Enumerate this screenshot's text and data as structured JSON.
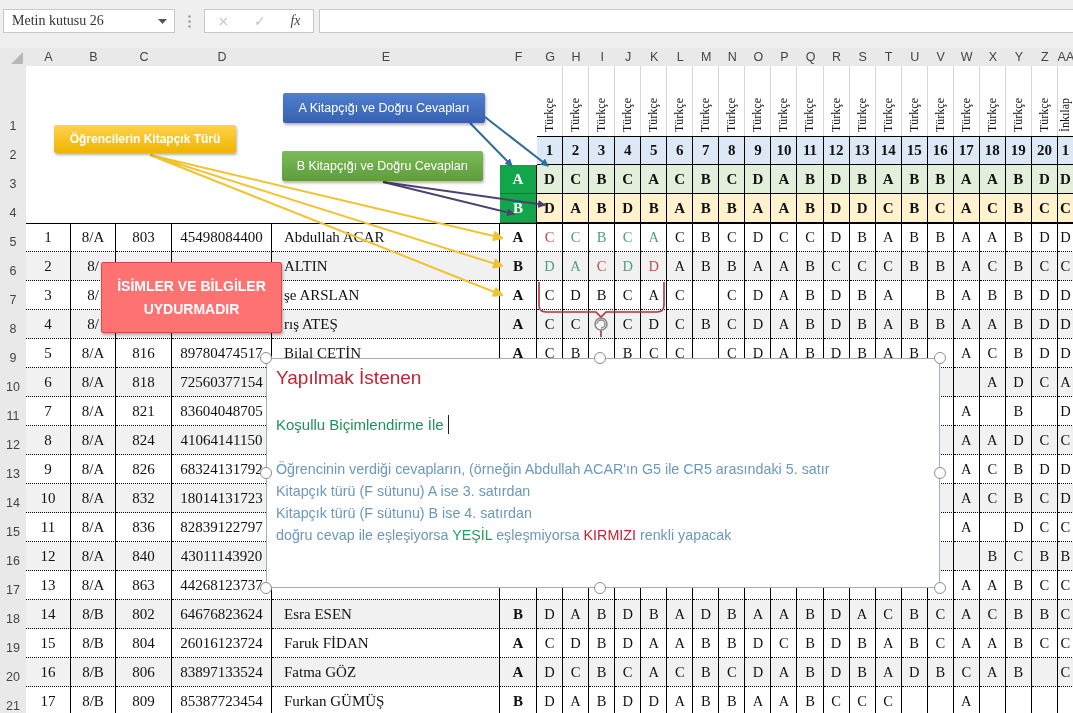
{
  "name_box": {
    "value": "Metin kutusu 26"
  },
  "formula_buttons": [
    {
      "label": "×",
      "disabled": true
    },
    {
      "label": "✓",
      "disabled": true
    },
    {
      "label": "fx",
      "disabled": false
    }
  ],
  "columns": [
    "A",
    "B",
    "C",
    "D",
    "E",
    "F",
    "G",
    "H",
    "I",
    "J",
    "K",
    "L",
    "M",
    "N",
    "O",
    "P",
    "Q",
    "R",
    "S",
    "T",
    "U",
    "V",
    "W",
    "X",
    "Y",
    "Z",
    "AA"
  ],
  "subject_row": {
    "number": "1",
    "subjects": [
      "Türkçe",
      "Türkçe",
      "Türkçe",
      "Türkçe",
      "Türkçe",
      "Türkçe",
      "Türkçe",
      "Türkçe",
      "Türkçe",
      "Türkçe",
      "Türkçe",
      "Türkçe",
      "Türkçe",
      "Türkçe",
      "Türkçe",
      "Türkçe",
      "Türkçe",
      "Türkçe",
      "Türkçe",
      "Türkçe",
      "İnkılap"
    ]
  },
  "question_row": {
    "number": "2",
    "questions": [
      "1",
      "2",
      "3",
      "4",
      "5",
      "6",
      "7",
      "8",
      "9",
      "10",
      "11",
      "12",
      "13",
      "14",
      "15",
      "16",
      "17",
      "18",
      "19",
      "20",
      "1"
    ]
  },
  "key_rows": [
    {
      "number": "3",
      "booklet": "A",
      "color": "#e2efda",
      "answers": [
        "D",
        "C",
        "B",
        "C",
        "A",
        "C",
        "B",
        "C",
        "D",
        "A",
        "B",
        "D",
        "B",
        "A",
        "B",
        "B",
        "A",
        "A",
        "B",
        "D",
        "D"
      ]
    },
    {
      "number": "4",
      "booklet": "B",
      "color": "#fff2cc",
      "answers": [
        "D",
        "A",
        "B",
        "D",
        "B",
        "A",
        "B",
        "B",
        "A",
        "A",
        "B",
        "D",
        "D",
        "C",
        "B",
        "C",
        "A",
        "C",
        "B",
        "C",
        "C"
      ]
    }
  ],
  "students": [
    {
      "number": "5",
      "no": "1",
      "class": "8/A",
      "school_no": "803",
      "id": "45498084400",
      "name": "Abdullah ACAR",
      "booklet": "A",
      "answers": [
        {
          "kind": "mark",
          "value": "C",
          "color": "#c0504d"
        },
        {
          "kind": "mark",
          "value": "C",
          "color": "#4f9d7f"
        },
        {
          "kind": "mark",
          "value": "B",
          "color": "#4f9d7f"
        },
        {
          "kind": "mark",
          "value": "C",
          "color": "#4f9d7f"
        },
        {
          "kind": "mark",
          "value": "A",
          "color": "#4f9d7f"
        },
        {
          "kind": "mark",
          "value": "C"
        },
        {
          "kind": "mark",
          "value": "B"
        },
        {
          "kind": "mark",
          "value": "C"
        },
        {
          "kind": "mark",
          "value": "D"
        },
        {
          "kind": "mark",
          "value": "C"
        },
        {
          "kind": "mark",
          "value": "C"
        },
        {
          "kind": "mark",
          "value": "D"
        },
        {
          "kind": "mark",
          "value": "B"
        },
        {
          "kind": "mark",
          "value": "A"
        },
        {
          "kind": "mark",
          "value": "B"
        },
        {
          "kind": "mark",
          "value": "B"
        },
        {
          "kind": "mark",
          "value": "A"
        },
        {
          "kind": "mark",
          "value": "A"
        },
        {
          "kind": "mark",
          "value": "B"
        },
        {
          "kind": "mark",
          "value": "D"
        },
        {
          "kind": "mark",
          "value": "D"
        }
      ]
    },
    {
      "number": "6",
      "no": "2",
      "class": "8/",
      "name": "ALTIN",
      "booklet": "B",
      "answers": [
        {
          "kind": "mark",
          "value": "D",
          "color": "#4f9d7f"
        },
        {
          "kind": "mark",
          "value": "A",
          "color": "#4f9d7f"
        },
        {
          "kind": "mark",
          "value": "C",
          "color": "#c0504d"
        },
        {
          "kind": "mark",
          "value": "D",
          "color": "#4f9d7f"
        },
        {
          "kind": "mark",
          "value": "D",
          "color": "#c0504d"
        },
        {
          "kind": "mark",
          "value": "A"
        },
        {
          "kind": "mark",
          "value": "B"
        },
        {
          "kind": "mark",
          "value": "B"
        },
        {
          "kind": "mark",
          "value": "A"
        },
        {
          "kind": "mark",
          "value": "A"
        },
        {
          "kind": "mark",
          "value": "B"
        },
        {
          "kind": "mark",
          "value": "C"
        },
        {
          "kind": "mark",
          "value": "C"
        },
        {
          "kind": "mark",
          "value": "C"
        },
        {
          "kind": "mark",
          "value": "B"
        },
        {
          "kind": "mark",
          "value": "B"
        },
        {
          "kind": "mark",
          "value": "A"
        },
        {
          "kind": "mark",
          "value": "C"
        },
        {
          "kind": "mark",
          "value": "B"
        },
        {
          "kind": "mark",
          "value": "C"
        },
        {
          "kind": "mark",
          "value": "C"
        }
      ]
    },
    {
      "number": "7",
      "no": "3",
      "class": "8/",
      "name": "şe ARSLAN",
      "booklet": "A",
      "answers": [
        {
          "kind": "mark",
          "value": "C"
        },
        {
          "kind": "mark",
          "value": "D"
        },
        {
          "kind": "mark",
          "value": "B"
        },
        {
          "kind": "mark",
          "value": "C"
        },
        {
          "kind": "mark",
          "value": "A"
        },
        {
          "kind": "mark",
          "value": "C"
        },
        {
          "kind": "empty"
        },
        {
          "kind": "mark",
          "value": "C"
        },
        {
          "kind": "mark",
          "value": "D"
        },
        {
          "kind": "mark",
          "value": "A"
        },
        {
          "kind": "mark",
          "value": "B"
        },
        {
          "kind": "mark",
          "value": "D"
        },
        {
          "kind": "mark",
          "value": "B"
        },
        {
          "kind": "mark",
          "value": "A"
        },
        {
          "kind": "empty"
        },
        {
          "kind": "mark",
          "value": "B"
        },
        {
          "kind": "mark",
          "value": "A"
        },
        {
          "kind": "mark",
          "value": "B"
        },
        {
          "kind": "mark",
          "value": "B"
        },
        {
          "kind": "mark",
          "value": "D"
        },
        {
          "kind": "mark",
          "value": "D"
        }
      ]
    },
    {
      "number": "8",
      "no": "4",
      "class": "8/",
      "name": "rış ATEŞ",
      "booklet": "A",
      "answers": [
        {
          "kind": "mark",
          "value": "C"
        },
        {
          "kind": "mark",
          "value": "C"
        },
        {
          "kind": "empty"
        },
        {
          "kind": "mark",
          "value": "C"
        },
        {
          "kind": "mark",
          "value": "D"
        },
        {
          "kind": "mark",
          "value": "C"
        },
        {
          "kind": "mark",
          "value": "B"
        },
        {
          "kind": "mark",
          "value": "C"
        },
        {
          "kind": "mark",
          "value": "D"
        },
        {
          "kind": "mark",
          "value": "A"
        },
        {
          "kind": "mark",
          "value": "B"
        },
        {
          "kind": "mark",
          "value": "D"
        },
        {
          "kind": "mark",
          "value": "B"
        },
        {
          "kind": "mark",
          "value": "A"
        },
        {
          "kind": "mark",
          "value": "B"
        },
        {
          "kind": "mark",
          "value": "B"
        },
        {
          "kind": "mark",
          "value": "A"
        },
        {
          "kind": "mark",
          "value": "A"
        },
        {
          "kind": "mark",
          "value": "B"
        },
        {
          "kind": "mark",
          "value": "D"
        },
        {
          "kind": "mark",
          "value": "D"
        }
      ]
    },
    {
      "number": "9",
      "no": "5",
      "class": "8/A",
      "school_no": "816",
      "id": "89780474517",
      "name": "Bilal ÇETİN",
      "booklet": "A",
      "answers": [
        {
          "kind": "mark",
          "value": "C"
        },
        {
          "kind": "mark",
          "value": "B"
        },
        {
          "kind": "empty"
        },
        {
          "kind": "mark",
          "value": "B"
        },
        {
          "kind": "mark",
          "value": "C"
        },
        {
          "kind": "mark",
          "value": "C"
        },
        {
          "kind": "empty"
        },
        {
          "kind": "mark",
          "value": "C"
        },
        {
          "kind": "mark",
          "value": "D"
        },
        {
          "kind": "mark",
          "value": "A"
        },
        {
          "kind": "mark",
          "value": "B"
        },
        {
          "kind": "mark",
          "value": "D"
        },
        {
          "kind": "mark",
          "value": "B"
        },
        {
          "kind": "mark",
          "value": "A"
        },
        {
          "kind": "mark",
          "value": "B"
        },
        {
          "kind": "empty"
        },
        {
          "kind": "mark",
          "value": "A"
        },
        {
          "kind": "mark",
          "value": "C"
        },
        {
          "kind": "mark",
          "value": "B"
        },
        {
          "kind": "mark",
          "value": "D"
        },
        {
          "kind": "mark",
          "value": "D"
        }
      ]
    },
    {
      "number": "10",
      "no": "6",
      "class": "8/A",
      "school_no": "818",
      "id": "72560377154",
      "answers": [
        {
          "kind": "empty"
        },
        {
          "kind": "mark",
          "value": "A"
        },
        {
          "kind": "mark",
          "value": "D"
        },
        {
          "kind": "mark",
          "value": "C"
        },
        {
          "kind": "mark",
          "value": "A"
        }
      ]
    },
    {
      "number": "11",
      "no": "7",
      "class": "8/A",
      "school_no": "821",
      "id": "83604048705",
      "answers": [
        {
          "kind": "mark",
          "value": "A"
        },
        {
          "kind": "empty"
        },
        {
          "kind": "mark",
          "value": "B"
        },
        {
          "kind": "empty"
        },
        {
          "kind": "mark",
          "value": "D"
        }
      ]
    },
    {
      "number": "12",
      "no": "8",
      "class": "8/A",
      "school_no": "824",
      "id": "41064141150",
      "answers": [
        {
          "kind": "mark",
          "value": "A"
        },
        {
          "kind": "mark",
          "value": "A"
        },
        {
          "kind": "mark",
          "value": "D"
        },
        {
          "kind": "mark",
          "value": "C"
        },
        {
          "kind": "mark",
          "value": "C"
        }
      ]
    },
    {
      "number": "13",
      "no": "9",
      "class": "8/A",
      "school_no": "826",
      "id": "68324131792",
      "answers": [
        {
          "kind": "mark",
          "value": "A"
        },
        {
          "kind": "mark",
          "value": "C"
        },
        {
          "kind": "mark",
          "value": "B"
        },
        {
          "kind": "mark",
          "value": "D"
        },
        {
          "kind": "mark",
          "value": "D"
        }
      ]
    },
    {
      "number": "14",
      "no": "10",
      "class": "8/A",
      "school_no": "832",
      "id": "18014131723",
      "answers": [
        {
          "kind": "mark",
          "value": "A"
        },
        {
          "kind": "mark",
          "value": "C"
        },
        {
          "kind": "mark",
          "value": "B"
        },
        {
          "kind": "mark",
          "value": "C"
        },
        {
          "kind": "mark",
          "value": "D"
        }
      ]
    },
    {
      "number": "15",
      "no": "11",
      "class": "8/A",
      "school_no": "836",
      "id": "82839122797",
      "answers": [
        {
          "kind": "mark",
          "value": "A"
        },
        {
          "kind": "empty"
        },
        {
          "kind": "mark",
          "value": "D"
        },
        {
          "kind": "mark",
          "value": "C"
        },
        {
          "kind": "mark",
          "value": "C"
        }
      ]
    },
    {
      "number": "16",
      "no": "12",
      "class": "8/A",
      "school_no": "840",
      "id": "43011143920",
      "answers": [
        {
          "kind": "empty"
        },
        {
          "kind": "mark",
          "value": "B"
        },
        {
          "kind": "mark",
          "value": "C"
        },
        {
          "kind": "mark",
          "value": "B"
        },
        {
          "kind": "mark",
          "value": "B"
        }
      ]
    },
    {
      "number": "17",
      "no": "13",
      "class": "8/A",
      "school_no": "863",
      "id": "44268123737",
      "answers": [
        {
          "kind": "mark",
          "value": "A"
        },
        {
          "kind": "mark",
          "value": "A"
        },
        {
          "kind": "mark",
          "value": "B"
        },
        {
          "kind": "mark",
          "value": "C"
        },
        {
          "kind": "mark",
          "value": "C"
        }
      ]
    },
    {
      "number": "18",
      "no": "14",
      "class": "8/B",
      "school_no": "802",
      "id": "64676823624",
      "name": "Esra ESEN",
      "booklet": "B",
      "answers": [
        {
          "kind": "mark",
          "value": "D"
        },
        {
          "kind": "mark",
          "value": "A"
        },
        {
          "kind": "mark",
          "value": "B"
        },
        {
          "kind": "mark",
          "value": "D"
        },
        {
          "kind": "mark",
          "value": "B"
        },
        {
          "kind": "mark",
          "value": "A"
        },
        {
          "kind": "mark",
          "value": "D"
        },
        {
          "kind": "mark",
          "value": "B"
        },
        {
          "kind": "mark",
          "value": "A"
        },
        {
          "kind": "mark",
          "value": "A"
        },
        {
          "kind": "mark",
          "value": "B"
        },
        {
          "kind": "mark",
          "value": "D"
        },
        {
          "kind": "mark",
          "value": "A"
        },
        {
          "kind": "mark",
          "value": "C"
        },
        {
          "kind": "mark",
          "value": "B"
        },
        {
          "kind": "mark",
          "value": "C"
        },
        {
          "kind": "mark",
          "value": "A"
        },
        {
          "kind": "mark",
          "value": "C"
        },
        {
          "kind": "mark",
          "value": "B"
        },
        {
          "kind": "mark",
          "value": "B"
        },
        {
          "kind": "mark",
          "value": "C"
        }
      ]
    },
    {
      "number": "19",
      "no": "15",
      "class": "8/B",
      "school_no": "804",
      "id": "26016123724",
      "name": "Faruk FİDAN",
      "booklet": "A",
      "answers": [
        {
          "kind": "mark",
          "value": "C"
        },
        {
          "kind": "mark",
          "value": "D"
        },
        {
          "kind": "mark",
          "value": "B"
        },
        {
          "kind": "mark",
          "value": "D"
        },
        {
          "kind": "mark",
          "value": "A"
        },
        {
          "kind": "mark",
          "value": "A"
        },
        {
          "kind": "mark",
          "value": "B"
        },
        {
          "kind": "mark",
          "value": "B"
        },
        {
          "kind": "mark",
          "value": "D"
        },
        {
          "kind": "mark",
          "value": "C"
        },
        {
          "kind": "mark",
          "value": "B"
        },
        {
          "kind": "mark",
          "value": "D"
        },
        {
          "kind": "mark",
          "value": "B"
        },
        {
          "kind": "mark",
          "value": "A"
        },
        {
          "kind": "mark",
          "value": "B"
        },
        {
          "kind": "mark",
          "value": "C"
        },
        {
          "kind": "mark",
          "value": "A"
        },
        {
          "kind": "mark",
          "value": "A"
        },
        {
          "kind": "mark",
          "value": "B"
        },
        {
          "kind": "mark",
          "value": "C"
        },
        {
          "kind": "mark",
          "value": "C"
        }
      ]
    },
    {
      "number": "20",
      "no": "16",
      "class": "8/B",
      "school_no": "806",
      "id": "83897133524",
      "name": "Fatma GÖZ",
      "booklet": "A",
      "answers": [
        {
          "kind": "mark",
          "value": "D"
        },
        {
          "kind": "mark",
          "value": "C"
        },
        {
          "kind": "mark",
          "value": "B"
        },
        {
          "kind": "mark",
          "value": "C"
        },
        {
          "kind": "mark",
          "value": "A"
        },
        {
          "kind": "mark",
          "value": "C"
        },
        {
          "kind": "mark",
          "value": "B"
        },
        {
          "kind": "mark",
          "value": "C"
        },
        {
          "kind": "mark",
          "value": "D"
        },
        {
          "kind": "mark",
          "value": "A"
        },
        {
          "kind": "mark",
          "value": "B"
        },
        {
          "kind": "mark",
          "value": "D"
        },
        {
          "kind": "mark",
          "value": "B"
        },
        {
          "kind": "mark",
          "value": "A"
        },
        {
          "kind": "mark",
          "value": "D"
        },
        {
          "kind": "mark",
          "value": "B"
        },
        {
          "kind": "mark",
          "value": "C"
        },
        {
          "kind": "mark",
          "value": "A"
        },
        {
          "kind": "mark",
          "value": "B"
        },
        {
          "kind": "empty"
        },
        {
          "kind": "mark",
          "value": "C"
        }
      ]
    },
    {
      "number": "21",
      "no": "17",
      "class": "8/B",
      "school_no": "809",
      "id": "85387723454",
      "name": "Furkan GÜMÜŞ",
      "booklet": "B",
      "answers": [
        {
          "kind": "mark",
          "value": "D"
        },
        {
          "kind": "mark",
          "value": "A"
        },
        {
          "kind": "mark",
          "value": "B"
        },
        {
          "kind": "mark",
          "value": "D"
        },
        {
          "kind": "mark",
          "value": "D"
        },
        {
          "kind": "mark",
          "value": "A"
        },
        {
          "kind": "mark",
          "value": "B"
        },
        {
          "kind": "mark",
          "value": "B"
        },
        {
          "kind": "mark",
          "value": "A"
        },
        {
          "kind": "mark",
          "value": "A"
        },
        {
          "kind": "mark",
          "value": "B"
        },
        {
          "kind": "mark",
          "value": "C"
        },
        {
          "kind": "mark",
          "value": "C"
        },
        {
          "kind": "mark",
          "value": "C"
        },
        {
          "kind": "empty"
        },
        {
          "kind": "empty"
        },
        {
          "kind": "mark",
          "value": "A"
        },
        {
          "kind": "empty"
        },
        {
          "kind": "empty"
        },
        {
          "kind": "empty"
        },
        {
          "kind": "empty"
        }
      ]
    }
  ],
  "callouts": [
    {
      "kind": "booklet_type",
      "text": "Öğrencilerin Kitapçık Türü"
    },
    {
      "kind": "key_a",
      "text": "A Kitapçığı ve Doğru Cevapları"
    },
    {
      "kind": "key_b",
      "text": "B Kitapçığı ve Doğru Cevapları"
    },
    {
      "kind": "notice",
      "text": "İSİMLER VE BİLGİLER UYDURMADIR"
    }
  ],
  "text_box": {
    "title": "Yapılmak İstenen",
    "subtitle": "Koşullu Biçimlendirme İle",
    "lines": [
      [
        {
          "text": "Öğrencinin verdiği cevapların, (örneğin Abdullah ACAR'ın G5 ile CR5 arasındaki 5. satır",
          "color": "#6b98bd"
        }
      ],
      [
        {
          "text": "Kitapçık türü (F sütunu) A ise 3. satırdan",
          "color": "#6b98bd"
        }
      ],
      [
        {
          "text": "Kitapçık türü (F sütunu) B ise 4. satırdan",
          "color": "#6b98bd"
        }
      ],
      [
        {
          "text": "doğru cevap ile eşleşiyorsa ",
          "color": "#6b98bd"
        },
        {
          "text": "YEŞİL",
          "color": "#23a05e"
        },
        {
          "text": " eşleşmiyorsa ",
          "color": "#6b98bd"
        },
        {
          "text": "KIRMIZI",
          "color": "#c52331"
        },
        {
          "text": " renkli yapacak",
          "color": "#6b98bd"
        }
      ]
    ]
  }
}
